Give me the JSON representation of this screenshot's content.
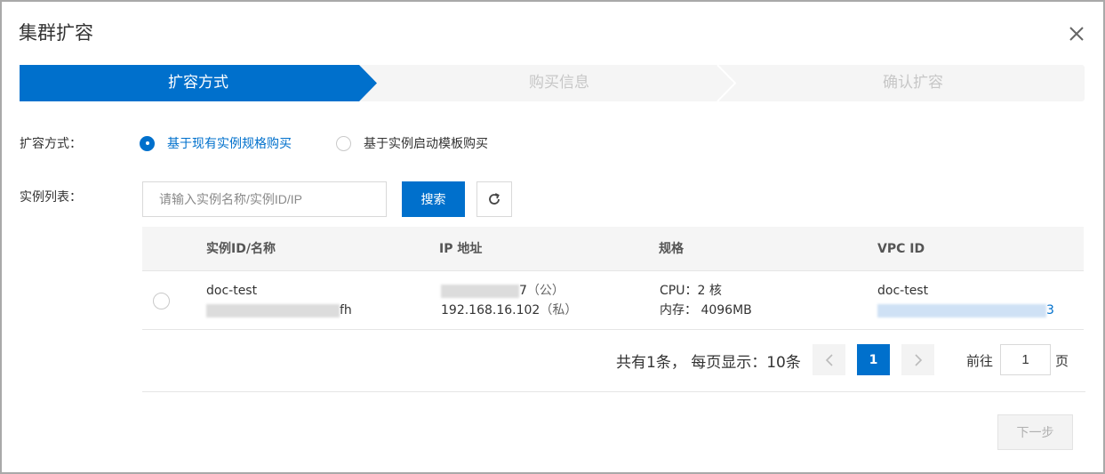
{
  "dialog": {
    "title": "集群扩容"
  },
  "steps": [
    {
      "label": "扩容方式",
      "state": "active"
    },
    {
      "label": "购买信息",
      "state": "pending"
    },
    {
      "label": "确认扩容",
      "state": "pending"
    }
  ],
  "form": {
    "mode_label": "扩容方式：",
    "mode_options": [
      {
        "label": "基于现有实例规格购买",
        "selected": true
      },
      {
        "label": "基于实例启动模板购买",
        "selected": false
      }
    ],
    "list_label": "实例列表："
  },
  "search": {
    "placeholder": "请输入实例名称/实例ID/IP",
    "value": "",
    "button_label": "搜索"
  },
  "table": {
    "columns": [
      "实例ID/名称",
      "IP 地址",
      "规格",
      "VPC ID"
    ],
    "rows": [
      {
        "selected": false,
        "name": "doc-test",
        "instance_id_visible_suffix": "fh",
        "public_ip_visible_suffix": "7",
        "public_tag": "（公）",
        "private_ip": "192.168.16.102",
        "private_tag": "（私）",
        "cpu": "CPU：2 核",
        "memory": "内存： 4096MB",
        "vpc_name": "doc-test",
        "vpc_id_visible_suffix": "3"
      }
    ]
  },
  "pagination": {
    "summary": "共有1条，  每页显示：10条",
    "current_page": "1",
    "goto_label": "前往",
    "goto_value": "1",
    "goto_suffix": "页"
  },
  "footer": {
    "next_label": "下一步"
  },
  "colors": {
    "primary": "#0070cc",
    "step_inactive_bg": "#f5f5f5",
    "disabled_text": "#b0b0b0"
  },
  "icons": [
    "close-icon",
    "refresh-icon",
    "chevron-left-icon",
    "chevron-right-icon"
  ]
}
